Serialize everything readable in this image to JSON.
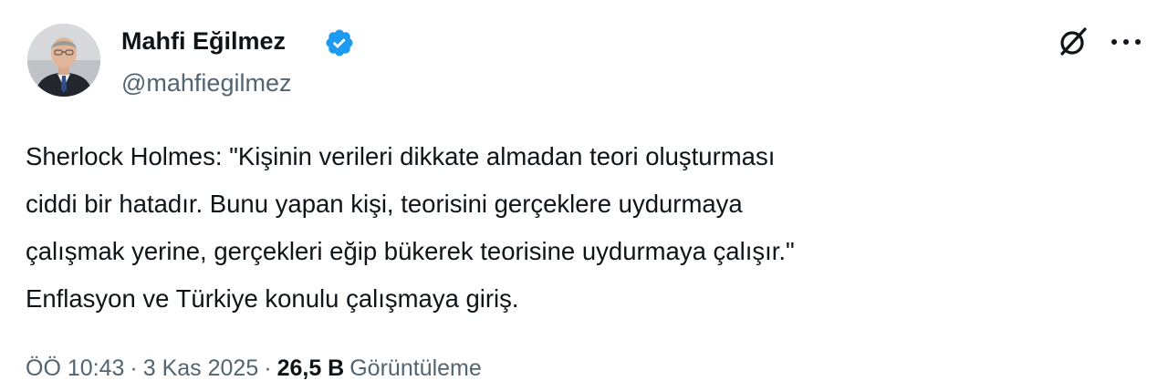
{
  "author": {
    "name": "Mahfi Eğilmez",
    "handle": "@mahfiegilmez",
    "verified": true
  },
  "header_icons": {
    "grok": "grok-icon",
    "more": "more-icon"
  },
  "tweet": {
    "lines": [
      "Sherlock Holmes: \"Kişinin verileri dikkate almadan teori oluşturması",
      "ciddi bir hatadır. Bunu yapan kişi, teorisini gerçeklere uydurmaya",
      "çalışmak yerine, gerçekleri eğip bükerek teorisine uydurmaya çalışır.\"",
      "Enflasyon ve Türkiye konulu çalışmaya giriş."
    ]
  },
  "meta": {
    "time": "ÖÖ 10:43",
    "separator": "·",
    "date": "3 Kas 2025",
    "views_count": "26,5 B",
    "views_label": "Görüntüleme"
  },
  "colors": {
    "text": "#0f1419",
    "secondary": "#536471",
    "verified_blue": "#1d9bf0",
    "background": "#ffffff"
  }
}
